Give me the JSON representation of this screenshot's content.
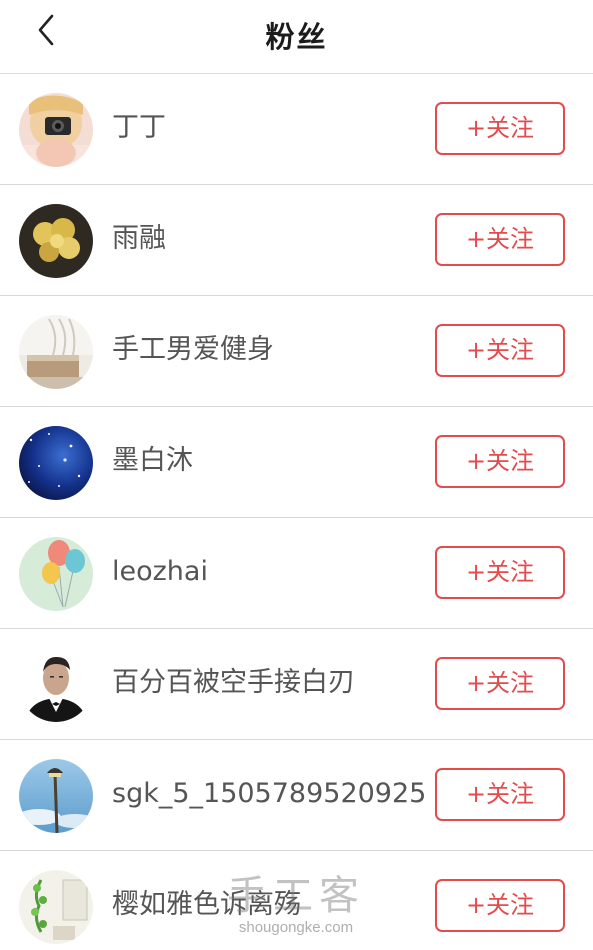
{
  "header": {
    "title": "粉丝",
    "back_icon": "chevron-left-icon"
  },
  "followers": [
    {
      "name": "丁丁",
      "button": "+关注",
      "avatar": "girl-with-camera"
    },
    {
      "name": "雨融",
      "button": "+关注",
      "avatar": "yellow-flower"
    },
    {
      "name": "手工男爱健身",
      "button": "+关注",
      "avatar": "interior-room"
    },
    {
      "name": "墨白沐",
      "button": "+关注",
      "avatar": "starry-sky"
    },
    {
      "name": "leozhai",
      "button": "+关注",
      "avatar": "balloons"
    },
    {
      "name": "百分百被空手接白刃",
      "button": "+关注",
      "avatar": "man-in-tuxedo"
    },
    {
      "name": "sgk_5_1505789520925",
      "button": "+关注",
      "avatar": "street-lamp"
    },
    {
      "name": "樱如雅色诉离殇",
      "button": "+关注",
      "avatar": "green-plant"
    }
  ],
  "watermark": {
    "main": "手工客",
    "sub": "shougongke.com"
  },
  "colors": {
    "accent": "#e24c4c",
    "text": "#555555",
    "title": "#1c1c1c",
    "divider": "#d8d8d8"
  }
}
